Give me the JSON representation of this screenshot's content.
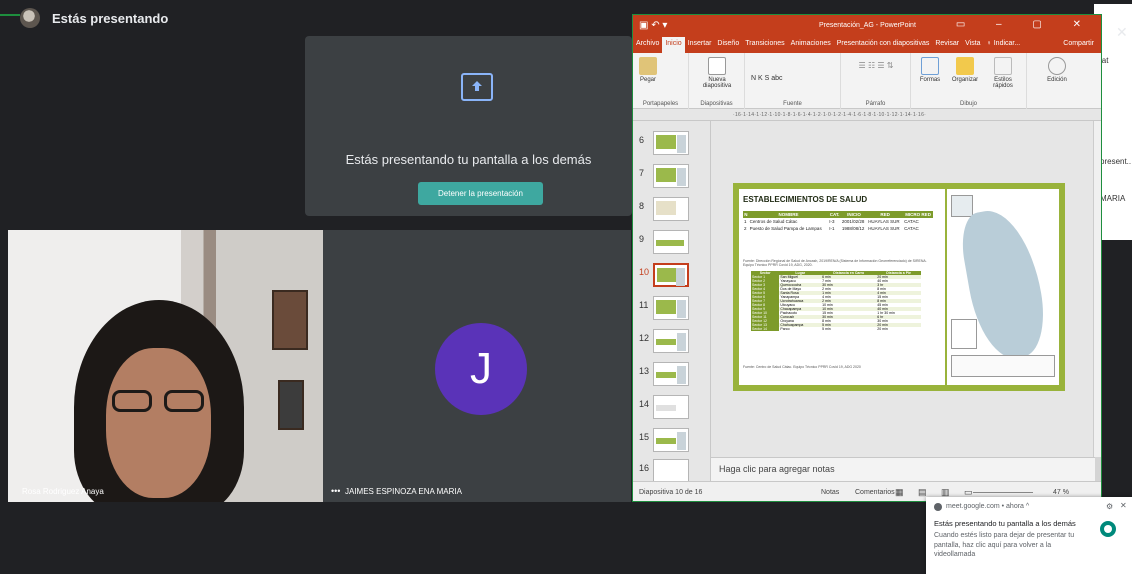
{
  "meet": {
    "presenting_label": "Estás presentando",
    "present_tile_text": "Estás presentando tu pantalla a los demás",
    "stop_button": "Detener la presentación",
    "participants": [
      {
        "name": "Rosa Rodriguez Anaya"
      },
      {
        "name": "JAIMES ESPINOZA ENA MARIA",
        "initial": "J"
      }
    ],
    "side_texts": [
      "iat",
      "present..",
      "MARIA"
    ]
  },
  "powerpoint": {
    "title": "Presentación_AG - PowerPoint",
    "tabs": [
      "Archivo",
      "Inicio",
      "Insertar",
      "Diseño",
      "Transiciones",
      "Animaciones",
      "Presentación con diapositivas",
      "Revisar",
      "Vista",
      "♀ Indicar..."
    ],
    "active_tab": "Inicio",
    "share": "Compartir",
    "ribbon_groups": [
      {
        "name": "Portapapeles",
        "buttons": [
          "Pegar"
        ]
      },
      {
        "name": "Diapositivas",
        "buttons": [
          "Nueva diapositiva"
        ]
      },
      {
        "name": "Fuente",
        "buttons": [
          "N K S abc"
        ]
      },
      {
        "name": "Párrafo",
        "buttons": []
      },
      {
        "name": "Dibujo",
        "buttons": [
          "Formas",
          "Organizar",
          "Estilos rápidos"
        ]
      },
      {
        "name": "",
        "buttons": [
          "Edición"
        ]
      }
    ],
    "ruler": "·16·1·14·1·12·1·10·1·8·1·6·1·4·1·2·1·0·1·2·1·4·1·6·1·8·1·10·1·12·1·14·1·16·",
    "slide_numbers": [
      "6",
      "7",
      "8",
      "9",
      "10",
      "11",
      "12",
      "13",
      "14",
      "15",
      "16"
    ],
    "active_slide": "10",
    "slide": {
      "title": "ESTABLECIMIENTOS DE SALUD",
      "headers": [
        "N",
        "NOMBRE",
        "CAT.",
        "INICIO",
        "RED",
        "MICRO RED"
      ],
      "rows": [
        [
          "1",
          "Centros de Salud Cátac",
          "I-3",
          "2001/02/28",
          "HUAYLAS SUR",
          "CATAC"
        ],
        [
          "2",
          "Puesto de Salud Pampa de Lampas",
          "I-1",
          "1988/08/12",
          "HUAYLAS SUR",
          "CATAC"
        ]
      ],
      "note": "Fuente: Dirección Regional de Salud de Ancash, 2019/REN/A (Sistema de Información Georreferenciado) de SIRENA. Equipo Técnico PPRR Covid 19, ADG, 2020.",
      "t2_headers": [
        "Sector",
        "Lugar",
        "Distancia en Carro",
        "Distancia a Pie"
      ],
      "t2_rows": [
        [
          "Sector 1",
          "San Miguel",
          "6 min",
          "20 min"
        ],
        [
          "Sector 2",
          "Yanayacu",
          "7 min",
          "40 min"
        ],
        [
          "Sector 3",
          "Queroccocha",
          "30 min",
          "3 hr"
        ],
        [
          "Sector 4",
          "Dos de Mayo",
          "2 min",
          "8 min"
        ],
        [
          "Sector 5",
          "Santa Rosa",
          "1 min",
          "4 min"
        ],
        [
          "Sector 6",
          "Yanapampa",
          "4 min",
          "15 min"
        ],
        [
          "Sector 7",
          "Ucrotrahuanca",
          "2 min",
          "8 min"
        ],
        [
          "Sector 8",
          "Utcuyacu",
          "10 min",
          "45 min"
        ],
        [
          "Sector 9",
          "Chacapampa",
          "10 min",
          "40 min"
        ],
        [
          "Sector 10",
          "Pachacoto",
          "15 min",
          "1 hr 30 min"
        ],
        [
          "Sector 11",
          "Cuncush",
          "30 min",
          "6 hr"
        ],
        [
          "Sector 12",
          "Oroyana",
          "8 min",
          "30 min"
        ],
        [
          "Sector 13",
          "Chahuapampa",
          "5 min",
          "20 min"
        ],
        [
          "Sector 14",
          "Parco",
          "5 min",
          "20 min"
        ]
      ],
      "source": "Fuente: Centro de Salud Cátac. Equipo Técnico PPRR Covid 19, ADG 2020"
    },
    "notes_placeholder": "Haga clic para agregar notas",
    "status_slide": "Diapositiva 10 de 16",
    "status_notes": "Notas",
    "status_comments": "Comentarios",
    "zoom": "47 %"
  },
  "toast": {
    "header": "meet.google.com • ahora ^",
    "title": "Estás presentando tu pantalla a los demás",
    "body": "Cuando estés listo para dejar de presentar tu pantalla, haz clic aquí para volver a la videollamada"
  },
  "colors": {
    "meet_bg": "#202124",
    "ppt_accent": "#c43e1c",
    "slide_green": "#99b33b",
    "stop_button": "#3ea8a0",
    "avatar_purple": "#5a33b8"
  }
}
